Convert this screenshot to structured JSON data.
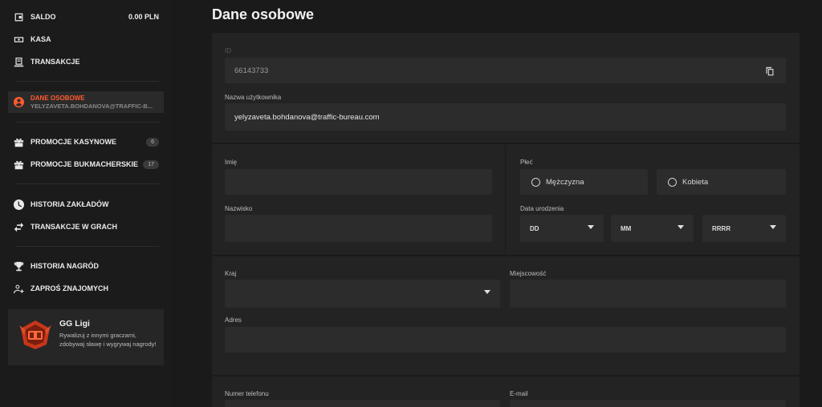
{
  "sidebar": {
    "saldo": {
      "label": "SALDO",
      "value": "0.00 PLN"
    },
    "kasa": {
      "label": "KASA"
    },
    "transakcje": {
      "label": "TRANSAKCJE"
    },
    "profile": {
      "label": "DANE OSOBOWE",
      "email": "YELYZAVETA.BOHDANOVA@TRAFFIC-B..."
    },
    "promocje_kasynowe": {
      "label": "PROMOCJE KASYNOWE",
      "count": "6"
    },
    "promocje_bukmacherskie": {
      "label": "PROMOCJE BUKMACHERSKIE",
      "count": "17"
    },
    "historia_zakladow": {
      "label": "HISTORIA ZAKŁADÓW"
    },
    "transakcje_w_grach": {
      "label": "TRANSAKCJE W GRACH"
    },
    "historia_nagrod": {
      "label": "HISTORIA NAGRÓD"
    },
    "zapros_znajomych": {
      "label": "ZAPROŚ ZNAJOMYCH"
    },
    "gg_card": {
      "title": "GG Ligi",
      "description": "Rywalizuj z innymi graczami, zdobywaj sławę i wygrywaj nagrody!"
    }
  },
  "main": {
    "title": "Dane osobowe",
    "id": {
      "label": "ID",
      "value": "66143733"
    },
    "username": {
      "label": "Nazwa użytkownika",
      "value": "yelyzaveta.bohdanova@traffic-bureau.com"
    },
    "imie": {
      "label": "Imię",
      "value": ""
    },
    "nazwisko": {
      "label": "Nazwisko",
      "value": ""
    },
    "plec": {
      "label": "Płeć",
      "option1": "Mężczyzna",
      "option2": "Kobieta"
    },
    "birth": {
      "label": "Data urodzenia",
      "day": "DD",
      "month": "MM",
      "year": "RRRR"
    },
    "kraj": {
      "label": "Kraj",
      "value": ""
    },
    "miejscowosc": {
      "label": "Miejscowość",
      "value": ""
    },
    "adres": {
      "label": "Adres",
      "value": ""
    },
    "telefon": {
      "label": "Numer telefonu"
    },
    "email": {
      "label": "E-mail"
    }
  },
  "colors": {
    "accent": "#ff5b2e",
    "background": "#1a1a1a",
    "panel": "#232323",
    "field": "#2c2c2c"
  }
}
